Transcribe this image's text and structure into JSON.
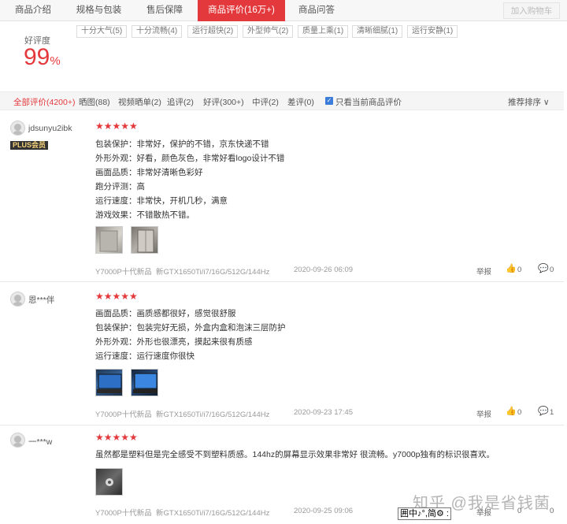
{
  "tabs": [
    {
      "label": "商品介绍"
    },
    {
      "label": "规格与包装"
    },
    {
      "label": "售后保障"
    },
    {
      "label": "商品评价(16万+)"
    },
    {
      "label": "商品问答"
    }
  ],
  "cart_button": "加入购物车",
  "summary": {
    "label": "好评度",
    "value": "99",
    "unit": "%",
    "tags": [
      "十分大气(5)",
      "十分流畅(4)",
      "运行超快(2)",
      "外型帅气(2)",
      "质量上乘(1)",
      "清晰细腻(1)",
      "运行安静(1)"
    ]
  },
  "filters": {
    "items": [
      "全部评价(4200+)",
      "晒图(88)",
      "视频晒单(2)",
      "追评(2)",
      "好评(300+)",
      "中评(2)",
      "差评(0)"
    ],
    "current_only": "只看当前商品评价",
    "sort": "推荐排序"
  },
  "reviews": [
    {
      "user": "jdsunyu2ibk",
      "badge": "PLUS会员",
      "lines": [
        "包装保护：非常好，保护的不错，京东快递不错",
        "外形外观：好看，颜色灰色，非常好看logo设计不错",
        "画面品质：非常好清晰色彩好",
        "跑分评测：高",
        "运行速度：非常快，开机几秒，满意",
        "游戏效果：不错散热不错。"
      ],
      "model": "Y7000P十代新品",
      "spec": "新GTX1650Ti/i7/16G/512G/144Hz",
      "date": "2020-09-26 06:09",
      "report": "举报",
      "likes": "0",
      "comments": "0"
    },
    {
      "user": "恩***伴",
      "badge": "",
      "lines": [
        "画面品质：画质感都很好，感觉很舒服",
        "包装保护：包装完好无损，外盒内盒和泡沫三层防护",
        "外形外观：外形也很漂亮，摸起来很有质感",
        "运行速度：运行速度你很快"
      ],
      "model": "Y7000P十代新品",
      "spec": "新GTX1650Ti/i7/16G/512G/144Hz",
      "date": "2020-09-23 17:45",
      "report": "举报",
      "likes": "0",
      "comments": "1"
    },
    {
      "user": "一***w",
      "badge": "",
      "lines": [
        "虽然都是塑料但是完全感受不到塑料质感。144hz的屏幕显示效果非常好 很流畅。y7000p独有的标识很喜欢。"
      ],
      "model": "Y7000P十代新品",
      "spec": "新GTX1650Ti/i7/16G/512G/144Hz",
      "date": "2020-09-25 09:06",
      "report": "举报",
      "likes": "0",
      "comments": "0"
    }
  ],
  "stars": "★★★★★",
  "watermark": "知乎 @我是省钱菌",
  "ime": "囲中♪°,简⚙ :",
  "colors": {
    "accent": "#e4393c",
    "checkbox": "#3b7dd8"
  }
}
